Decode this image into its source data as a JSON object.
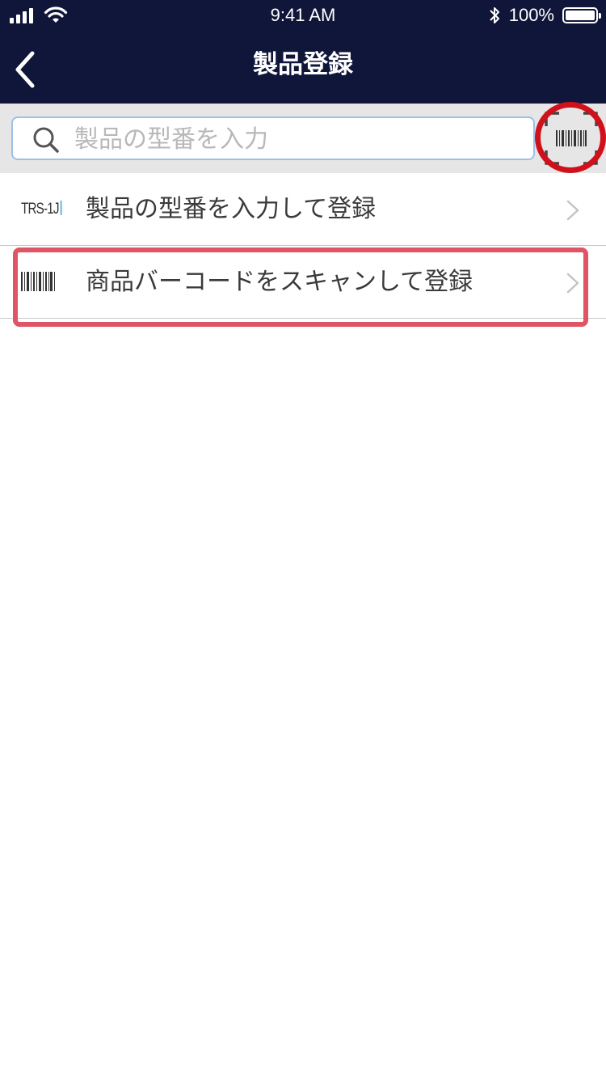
{
  "status_bar": {
    "time": "9:41 AM",
    "battery": "100%",
    "battery_level": 1.0
  },
  "nav": {
    "title": "製品登録",
    "back_icon": "chevron-left-icon"
  },
  "search": {
    "placeholder": "製品の型番を入力",
    "value": "",
    "scan_icon": "barcode-scan-icon"
  },
  "list": {
    "items": [
      {
        "icon_text": "TRS-1J",
        "label": "製品の型番を入力して登録"
      },
      {
        "icon": "barcode-icon",
        "label": "商品バーコードをスキャンして登録"
      }
    ]
  },
  "colors": {
    "header_bg": "#10163a",
    "search_bg": "#e6e6e6",
    "highlight_red": "#d0111b",
    "highlight_pink": "#e05565"
  }
}
